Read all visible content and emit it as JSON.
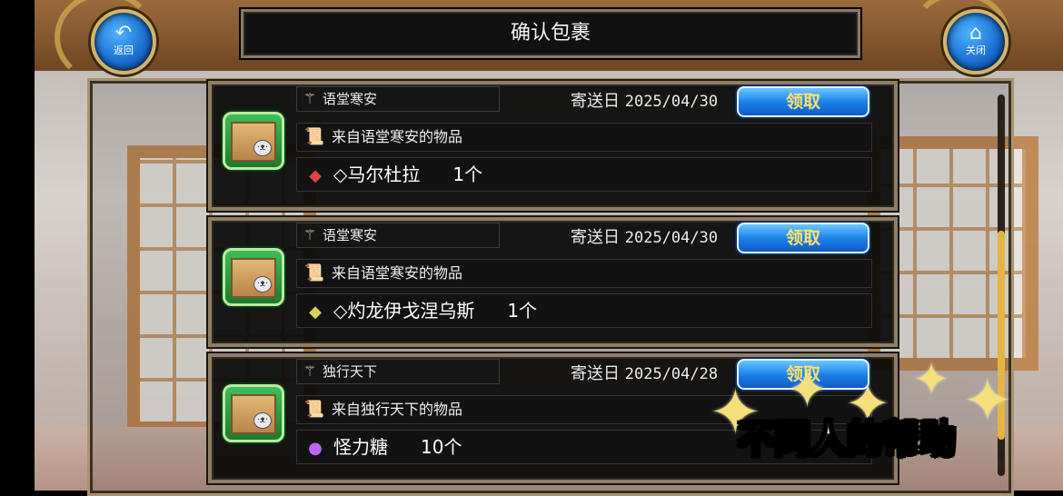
{
  "header": {
    "title": "确认包裹",
    "back_button": {
      "label": "返回",
      "icon": "back-arrow-icon"
    },
    "close_button": {
      "label": "关闭",
      "icon": "home-icon"
    }
  },
  "parcels": [
    {
      "sender": "语堂寒安",
      "date_label": "寄送日",
      "date": "2025/04/30",
      "claim_label": "领取",
      "description": "来自语堂寒安的物品",
      "item_name": "◇马尔杜拉",
      "item_qty": "1个",
      "item_icon": "blade-icon"
    },
    {
      "sender": "语堂寒安",
      "date_label": "寄送日",
      "date": "2025/04/30",
      "claim_label": "领取",
      "description": "来自语堂寒安的物品",
      "item_name": "◇灼龙伊戈涅乌斯",
      "item_qty": "1个",
      "item_icon": "blade-icon"
    },
    {
      "sender": "独行天下",
      "date_label": "寄送日",
      "date": "2025/04/28",
      "claim_label": "领取",
      "description": "来自独行天下的物品",
      "item_name": "怪力糖",
      "item_qty": "10个",
      "item_icon": "candy-icon"
    }
  ],
  "overlay": {
    "caption": "不同人的帮助"
  },
  "colors": {
    "claim_text": "#ffe16a",
    "claim_bg": "#1d83ea",
    "frame": "#8f7e63",
    "accent_gold": "#e2b640"
  }
}
